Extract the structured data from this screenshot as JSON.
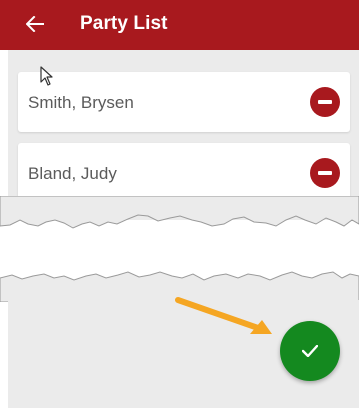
{
  "appbar": {
    "title": "Party List",
    "back_icon": "arrow-left-icon",
    "color": "#a8191e"
  },
  "party_list": [
    {
      "name": "Smith, Brysen",
      "action_icon": "remove-circle-icon"
    },
    {
      "name": "Bland, Judy",
      "action_icon": "remove-circle-icon"
    }
  ],
  "fab": {
    "icon": "check-icon",
    "color": "#14891f"
  },
  "annotation": {
    "arrow_color": "#f5a623"
  }
}
